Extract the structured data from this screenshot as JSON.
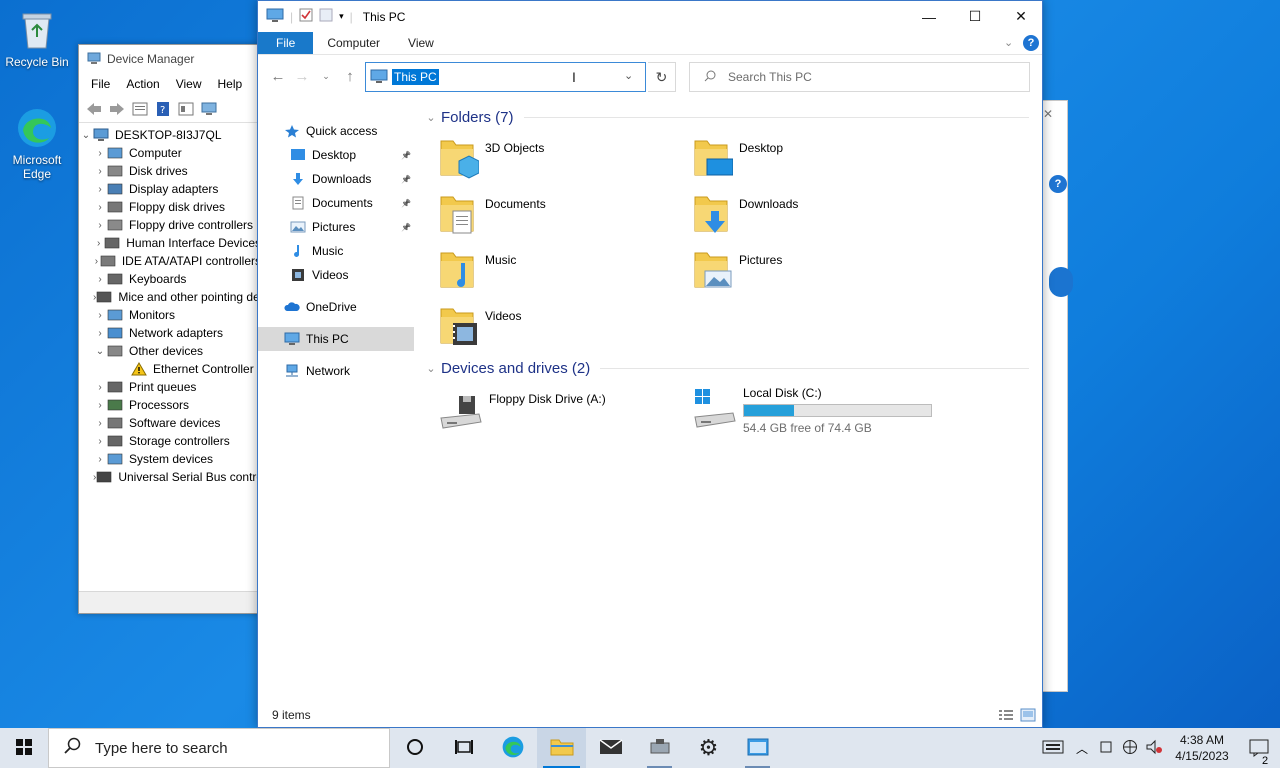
{
  "desktop": {
    "icons": [
      {
        "label": "Recycle Bin"
      },
      {
        "label": "Microsoft Edge"
      }
    ]
  },
  "device_manager": {
    "title": "Device Manager",
    "menu": [
      "File",
      "Action",
      "View",
      "Help"
    ],
    "root": "DESKTOP-8I3J7QL",
    "tree": [
      {
        "label": "Computer",
        "expander": "›"
      },
      {
        "label": "Disk drives",
        "expander": "›"
      },
      {
        "label": "Display adapters",
        "expander": "›"
      },
      {
        "label": "Floppy disk drives",
        "expander": "›"
      },
      {
        "label": "Floppy drive controllers",
        "expander": "›"
      },
      {
        "label": "Human Interface Devices",
        "expander": "›"
      },
      {
        "label": "IDE ATA/ATAPI controllers",
        "expander": "›"
      },
      {
        "label": "Keyboards",
        "expander": "›"
      },
      {
        "label": "Mice and other pointing devices",
        "expander": "›"
      },
      {
        "label": "Monitors",
        "expander": "›"
      },
      {
        "label": "Network adapters",
        "expander": "›"
      },
      {
        "label": "Other devices",
        "expander": "⌄"
      },
      {
        "label": "Ethernet Controller",
        "expander": "",
        "child": true
      },
      {
        "label": "Print queues",
        "expander": "›"
      },
      {
        "label": "Processors",
        "expander": "›"
      },
      {
        "label": "Software devices",
        "expander": "›"
      },
      {
        "label": "Storage controllers",
        "expander": "›"
      },
      {
        "label": "System devices",
        "expander": "›"
      },
      {
        "label": "Universal Serial Bus controllers",
        "expander": "›"
      }
    ]
  },
  "explorer": {
    "title": "This PC",
    "ribbon_tabs": [
      "File",
      "Computer",
      "View"
    ],
    "address": "This PC",
    "search_placeholder": "Search This PC",
    "nav_pane": [
      {
        "label": "Quick access",
        "pinned": false,
        "indent": 0
      },
      {
        "label": "Desktop",
        "pinned": true,
        "indent": 1
      },
      {
        "label": "Downloads",
        "pinned": true,
        "indent": 1
      },
      {
        "label": "Documents",
        "pinned": true,
        "indent": 1
      },
      {
        "label": "Pictures",
        "pinned": true,
        "indent": 1
      },
      {
        "label": "Music",
        "pinned": false,
        "indent": 1
      },
      {
        "label": "Videos",
        "pinned": false,
        "indent": 1
      },
      {
        "label": "OneDrive",
        "pinned": false,
        "indent": 0
      },
      {
        "label": "This PC",
        "pinned": false,
        "indent": 0,
        "selected": true
      },
      {
        "label": "Network",
        "pinned": false,
        "indent": 0
      }
    ],
    "folders_header": "Folders (7)",
    "folders": [
      "3D Objects",
      "Desktop",
      "Documents",
      "Downloads",
      "Music",
      "Pictures",
      "Videos"
    ],
    "devices_header": "Devices and drives (2)",
    "drives": [
      {
        "label": "Floppy Disk Drive (A:)"
      },
      {
        "label": "Local Disk (C:)",
        "free_text": "54.4 GB free of 74.4 GB",
        "used_fraction": 0.27
      }
    ],
    "status": "9 items"
  },
  "taskbar": {
    "search_placeholder": "Type here to search",
    "time": "4:38 AM",
    "date": "4/15/2023",
    "notification_count": "2"
  },
  "colors": {
    "accent": "#0078d7",
    "file_tab": "#1979ca",
    "folder_yellow": "#f2c94c",
    "drive_fill": "#26a0da"
  }
}
